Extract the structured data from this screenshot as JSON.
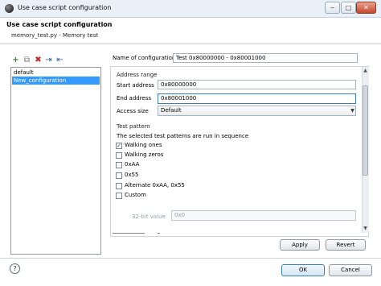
{
  "window": {
    "title": "Use case script configuration",
    "minimize_glyph": "‒",
    "maximize_glyph": "□",
    "close_glyph": "✕"
  },
  "header": {
    "title": "Use case script configuration",
    "subtitle": "memory_test.py - Memory test"
  },
  "toolbar": {
    "new_icon": "+",
    "copy_icon": "⧉",
    "delete_icon": "✖",
    "import_icon": "⇥",
    "export_icon": "⇤"
  },
  "configurations": {
    "items": [
      {
        "label": "default",
        "selected": false
      },
      {
        "label": "New_configuration",
        "selected": true
      }
    ]
  },
  "form": {
    "name_label": "Name of configuration:",
    "name_value": "Test 0x80000000 - 0x80001000",
    "address_range": {
      "title": "Address range",
      "start_label": "Start address",
      "start_value": "0x80000000",
      "end_label": "End address",
      "end_value": "0x80001000",
      "access_label": "Access size",
      "access_value": "Default",
      "access_arrow": "▼"
    },
    "test_pattern": {
      "title": "Test pattern",
      "description": "The selected test patterns are run in sequence",
      "patterns": [
        {
          "label": "Walking ones",
          "checked": true,
          "mark": "✓"
        },
        {
          "label": "Walking zeros",
          "checked": false,
          "mark": ""
        },
        {
          "label": "0xAA",
          "checked": false,
          "mark": ""
        },
        {
          "label": "0x55",
          "checked": false,
          "mark": ""
        },
        {
          "label": "Alternate 0xAA, 0x55",
          "checked": false,
          "mark": ""
        },
        {
          "label": "Custom",
          "checked": false,
          "mark": ""
        }
      ],
      "bit32_label": "32-bit value",
      "bit32_value": "0x0"
    },
    "scroll_up_glyph": "▲",
    "scroll_down_glyph": "▼"
  },
  "buttons": {
    "apply": "Apply",
    "revert": "Revert",
    "ok": "OK",
    "cancel": "Cancel",
    "help": "?"
  },
  "colors": {
    "selection": "#3399ff",
    "focus_border": "#3c7fb1"
  }
}
